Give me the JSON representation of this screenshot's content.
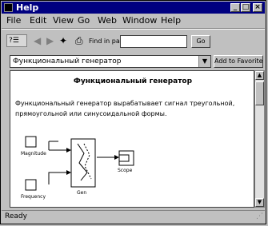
{
  "window": {
    "title": "Help"
  },
  "menubar": {
    "items": [
      {
        "label": "File"
      },
      {
        "label": "Edit"
      },
      {
        "label": "View"
      },
      {
        "label": "Go"
      },
      {
        "label": "Web"
      },
      {
        "label": "Window"
      },
      {
        "label": "Help"
      }
    ]
  },
  "toolbar": {
    "find_label": "Find in page:",
    "find_value": "",
    "go_label": "Go"
  },
  "topic": {
    "selected": "Функциональный генератор",
    "add_to_favorites": "Add to Favorites"
  },
  "document": {
    "heading": "Функциональный генератор",
    "paragraph": "Функциональный генератор вырабатывает сигнал треугольной, прямоугольной или синусоидальной формы.",
    "diagram": {
      "magnitude_label": "Magnitude",
      "frequency_label": "Frequency",
      "gen_label": "Gen",
      "scope_label": "Scope"
    }
  },
  "status": {
    "text": "Ready"
  },
  "colors": {
    "titlebar": "#000080",
    "face": "#c0c0c0"
  }
}
